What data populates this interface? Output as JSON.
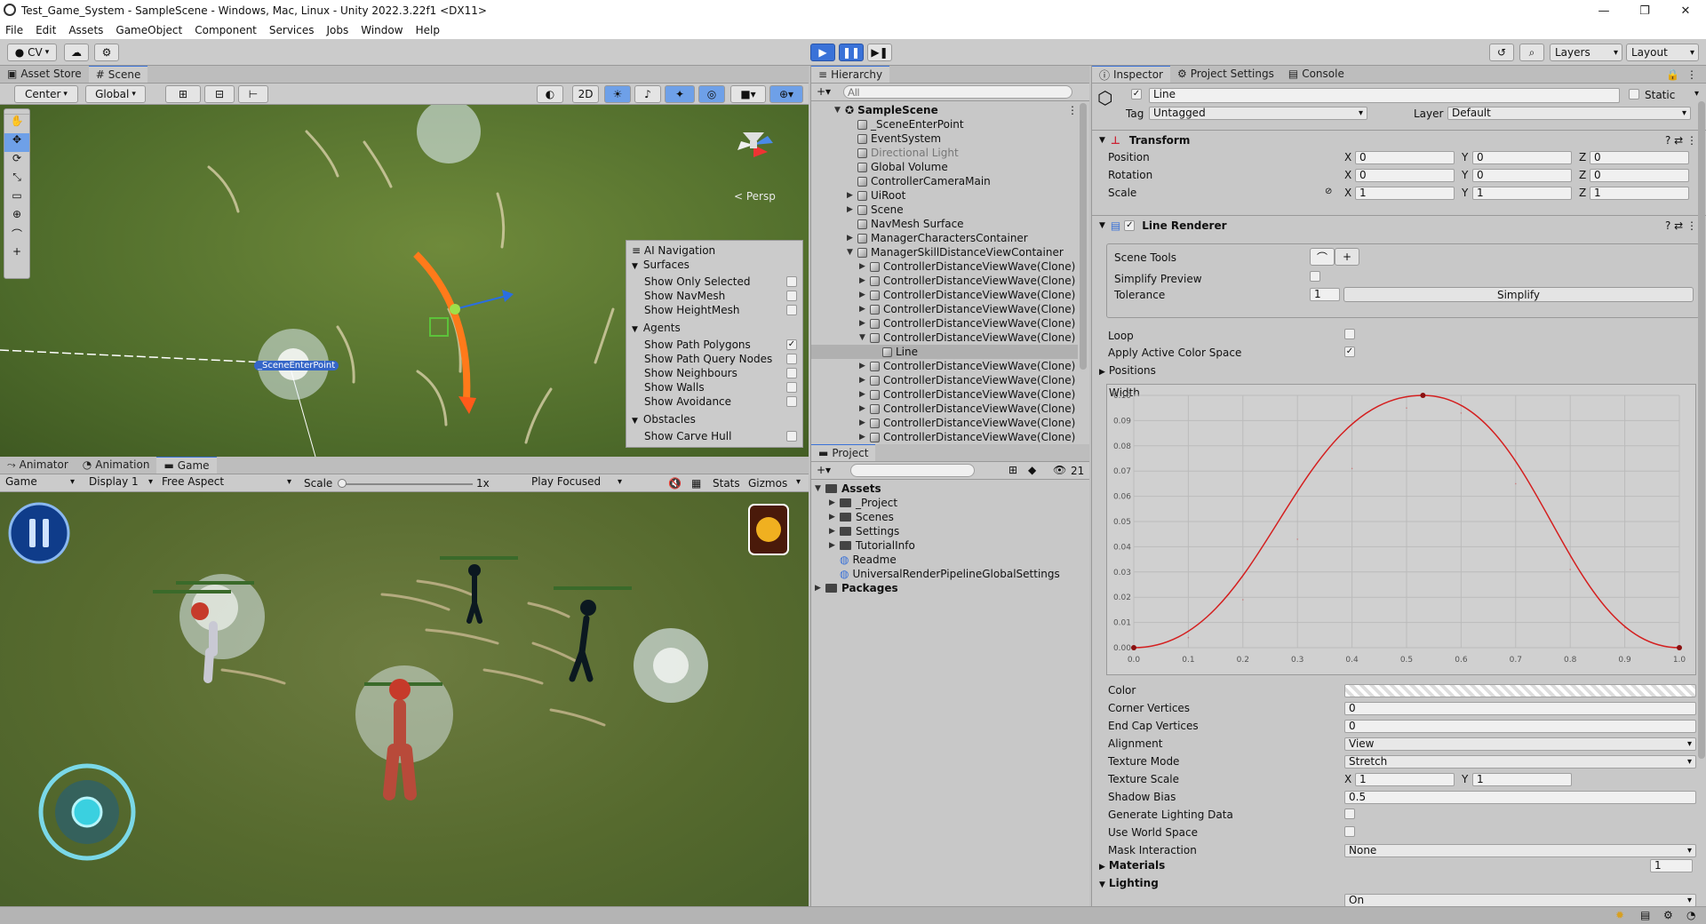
{
  "window": {
    "title": "Test_Game_System - SampleScene - Windows, Mac, Linux - Unity 2022.3.22f1 <DX11>",
    "minimize": "—",
    "maximize": "❐",
    "close": "✕"
  },
  "menu": [
    "File",
    "Edit",
    "Assets",
    "GameObject",
    "Component",
    "Services",
    "Jobs",
    "Window",
    "Help"
  ],
  "toolbar": {
    "account": "CV",
    "layers": "Layers",
    "layout": "Layout"
  },
  "scene_tabs": {
    "asset_store": "Asset Store",
    "scene": "Scene"
  },
  "scene_toolbar": {
    "pivot": "Center",
    "space": "Global",
    "mode_2d": "2D"
  },
  "scene_view": {
    "persp": "< Persp",
    "scene_enter_point": "_SceneEnterPoint"
  },
  "ai_nav": {
    "title": "AI Navigation",
    "sections": [
      {
        "name": "Surfaces",
        "items": [
          {
            "label": "Show Only Selected",
            "checked": false
          },
          {
            "label": "Show NavMesh",
            "checked": false
          },
          {
            "label": "Show HeightMesh",
            "checked": false
          }
        ]
      },
      {
        "name": "Agents",
        "items": [
          {
            "label": "Show Path Polygons",
            "checked": true
          },
          {
            "label": "Show Path Query Nodes",
            "checked": false
          },
          {
            "label": "Show Neighbours",
            "checked": false
          },
          {
            "label": "Show Walls",
            "checked": false
          },
          {
            "label": "Show Avoidance",
            "checked": false
          }
        ]
      },
      {
        "name": "Obstacles",
        "items": [
          {
            "label": "Show Carve Hull",
            "checked": false
          }
        ]
      }
    ]
  },
  "game_tabs": {
    "animator": "Animator",
    "animation": "Animation",
    "game": "Game"
  },
  "game_toolbar": {
    "mode": "Game",
    "display": "Display 1",
    "aspect": "Free Aspect",
    "scale_label": "Scale",
    "scale_value": "1x",
    "play_focus": "Play Focused",
    "stats": "Stats",
    "gizmos": "Gizmos"
  },
  "hierarchy": {
    "title": "Hierarchy",
    "search_placeholder": "All",
    "scene": "SampleScene",
    "items": [
      {
        "label": "_SceneEnterPoint",
        "indent": 1,
        "fold": "",
        "dim": false,
        "sel": false
      },
      {
        "label": "EventSystem",
        "indent": 1,
        "fold": "",
        "dim": false,
        "sel": false
      },
      {
        "label": "Directional Light",
        "indent": 1,
        "fold": "",
        "dim": true,
        "sel": false
      },
      {
        "label": "Global Volume",
        "indent": 1,
        "fold": "",
        "dim": false,
        "sel": false
      },
      {
        "label": "ControllerCameraMain",
        "indent": 1,
        "fold": "",
        "dim": false,
        "sel": false
      },
      {
        "label": "UiRoot",
        "indent": 1,
        "fold": "▶",
        "dim": false,
        "sel": false
      },
      {
        "label": "Scene",
        "indent": 1,
        "fold": "▶",
        "dim": false,
        "sel": false
      },
      {
        "label": "NavMesh Surface",
        "indent": 1,
        "fold": "",
        "dim": false,
        "sel": false
      },
      {
        "label": "ManagerCharactersContainer",
        "indent": 1,
        "fold": "▶",
        "dim": false,
        "sel": false
      },
      {
        "label": "ManagerSkillDistanceViewContainer",
        "indent": 1,
        "fold": "▼",
        "dim": false,
        "sel": false
      },
      {
        "label": "ControllerDistanceViewWave(Clone)",
        "indent": 2,
        "fold": "▶",
        "dim": false,
        "sel": false
      },
      {
        "label": "ControllerDistanceViewWave(Clone)",
        "indent": 2,
        "fold": "▶",
        "dim": false,
        "sel": false
      },
      {
        "label": "ControllerDistanceViewWave(Clone)",
        "indent": 2,
        "fold": "▶",
        "dim": false,
        "sel": false
      },
      {
        "label": "ControllerDistanceViewWave(Clone)",
        "indent": 2,
        "fold": "▶",
        "dim": false,
        "sel": false
      },
      {
        "label": "ControllerDistanceViewWave(Clone)",
        "indent": 2,
        "fold": "▶",
        "dim": false,
        "sel": false
      },
      {
        "label": "ControllerDistanceViewWave(Clone)",
        "indent": 2,
        "fold": "▼",
        "dim": false,
        "sel": false
      },
      {
        "label": "Line",
        "indent": 3,
        "fold": "",
        "dim": false,
        "sel": true
      },
      {
        "label": "ControllerDistanceViewWave(Clone)",
        "indent": 2,
        "fold": "▶",
        "dim": false,
        "sel": false
      },
      {
        "label": "ControllerDistanceViewWave(Clone)",
        "indent": 2,
        "fold": "▶",
        "dim": false,
        "sel": false
      },
      {
        "label": "ControllerDistanceViewWave(Clone)",
        "indent": 2,
        "fold": "▶",
        "dim": false,
        "sel": false
      },
      {
        "label": "ControllerDistanceViewWave(Clone)",
        "indent": 2,
        "fold": "▶",
        "dim": false,
        "sel": false
      },
      {
        "label": "ControllerDistanceViewWave(Clone)",
        "indent": 2,
        "fold": "▶",
        "dim": false,
        "sel": false
      },
      {
        "label": "ControllerDistanceViewWave(Clone)",
        "indent": 2,
        "fold": "▶",
        "dim": false,
        "sel": false
      }
    ]
  },
  "project": {
    "title": "Project",
    "count": "21",
    "items": [
      {
        "label": "Assets",
        "indent": 0,
        "fold": "▼",
        "bold": true,
        "icon": "folder"
      },
      {
        "label": "_Project",
        "indent": 1,
        "fold": "▶",
        "bold": false,
        "icon": "folder"
      },
      {
        "label": "Scenes",
        "indent": 1,
        "fold": "▶",
        "bold": false,
        "icon": "folder"
      },
      {
        "label": "Settings",
        "indent": 1,
        "fold": "▶",
        "bold": false,
        "icon": "folder"
      },
      {
        "label": "TutorialInfo",
        "indent": 1,
        "fold": "▶",
        "bold": false,
        "icon": "folder"
      },
      {
        "label": "Readme",
        "indent": 1,
        "fold": "",
        "bold": false,
        "icon": "asset"
      },
      {
        "label": "UniversalRenderPipelineGlobalSettings",
        "indent": 1,
        "fold": "",
        "bold": false,
        "icon": "asset"
      },
      {
        "label": "Packages",
        "indent": 0,
        "fold": "▶",
        "bold": true,
        "icon": "folder"
      }
    ]
  },
  "inspector": {
    "tabs": [
      "Inspector",
      "Project Settings",
      "Console"
    ],
    "object_name": "Line",
    "static_label": "Static",
    "tag_label": "Tag",
    "tag_value": "Untagged",
    "layer_label": "Layer",
    "layer_value": "Default",
    "transform": {
      "title": "Transform",
      "position": {
        "label": "Position",
        "x": "0",
        "y": "0",
        "z": "0"
      },
      "rotation": {
        "label": "Rotation",
        "x": "0",
        "y": "0",
        "z": "0"
      },
      "scale": {
        "label": "Scale",
        "x": "1",
        "y": "1",
        "z": "1"
      }
    },
    "line_renderer": {
      "title": "Line Renderer",
      "scene_tools": "Scene Tools",
      "simplify_preview": "Simplify Preview",
      "tolerance_label": "Tolerance",
      "tolerance_value": "1",
      "simplify_button": "Simplify",
      "loop": "Loop",
      "apply_active_color_space": "Apply Active Color Space",
      "positions": "Positions",
      "width_label": "Width"
    },
    "props": [
      {
        "label": "Color",
        "kind": "gradient",
        "value": ""
      },
      {
        "label": "Corner Vertices",
        "kind": "field",
        "value": "0"
      },
      {
        "label": "End Cap Vertices",
        "kind": "field",
        "value": "0"
      },
      {
        "label": "Alignment",
        "kind": "drop",
        "value": "View"
      },
      {
        "label": "Texture Mode",
        "kind": "drop",
        "value": "Stretch"
      },
      {
        "label": "Texture Scale",
        "kind": "xy",
        "value": ""
      },
      {
        "label": "Shadow Bias",
        "kind": "field",
        "value": "0.5"
      },
      {
        "label": "Generate Lighting Data",
        "kind": "check",
        "value": ""
      },
      {
        "label": "Use World Space",
        "kind": "check",
        "value": ""
      },
      {
        "label": "Mask Interaction",
        "kind": "drop",
        "value": "None"
      }
    ],
    "texture_scale": {
      "x": "1",
      "y": "1"
    },
    "materials": "Materials",
    "materials_count": "1",
    "lighting": "Lighting",
    "cast_shadows_value": "On"
  },
  "chart_data": {
    "type": "line",
    "title": "",
    "xlabel": "",
    "ylabel": "",
    "x": [
      0.0,
      0.1,
      0.2,
      0.3,
      0.4,
      0.5,
      0.53,
      0.6,
      0.7,
      0.8,
      0.9,
      1.0
    ],
    "y": [
      0.0,
      0.004,
      0.019,
      0.043,
      0.071,
      0.095,
      0.1,
      0.093,
      0.065,
      0.031,
      0.008,
      0.0
    ],
    "keys_x": [
      0.0,
      0.53,
      1.0
    ],
    "keys_y": [
      0.0,
      0.1,
      0.0
    ],
    "xticks": [
      "0.0",
      "0.1",
      "0.2",
      "0.3",
      "0.4",
      "0.5",
      "0.6",
      "0.7",
      "0.8",
      "0.9",
      "1.0"
    ],
    "yticks": [
      "0.00",
      "0.01",
      "0.02",
      "0.03",
      "0.04",
      "0.05",
      "0.06",
      "0.07",
      "0.08",
      "0.09",
      "0.10"
    ],
    "xlim": [
      0,
      1
    ],
    "ylim": [
      0,
      0.1
    ],
    "color": "#d42020",
    "grid": true
  }
}
